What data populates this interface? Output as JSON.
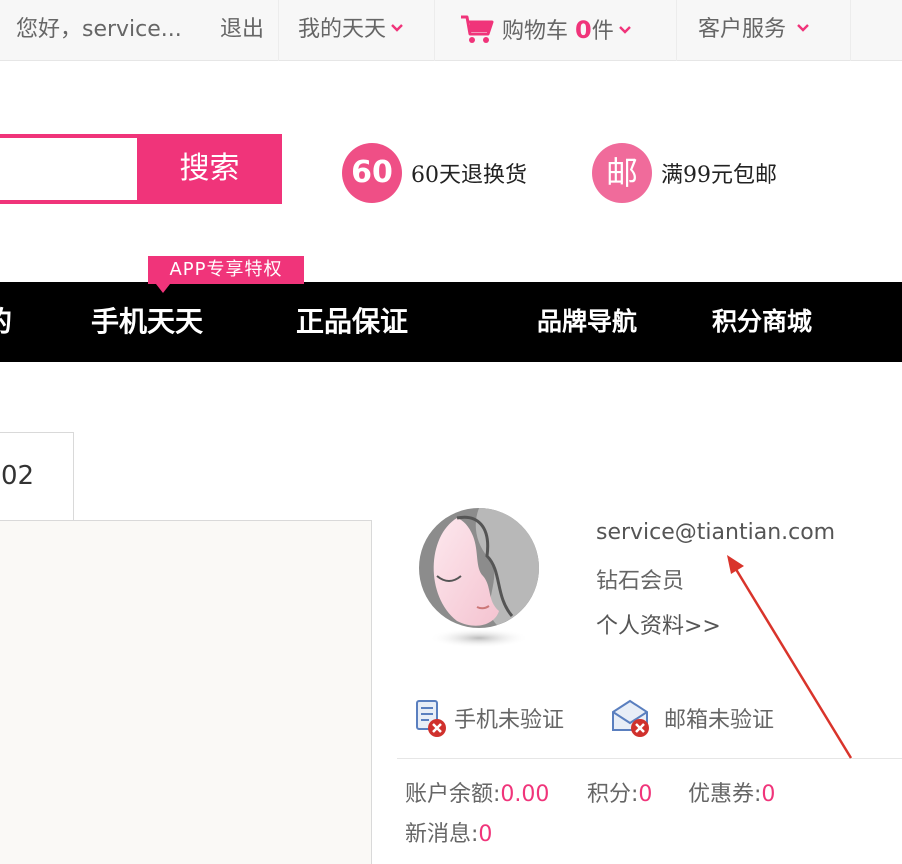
{
  "topbar": {
    "greeting": "您好，service...",
    "logout": "退出",
    "my_account": "我的天天",
    "cart_label": "购物车",
    "cart_count": "0",
    "cart_unit": "件",
    "customer_service": "客户服务"
  },
  "search": {
    "button_label": "搜索",
    "placeholder": ""
  },
  "promos": [
    {
      "badge": "60",
      "text": "60天退换货"
    },
    {
      "badge": "邮",
      "text": "满99元包邮"
    }
  ],
  "nav": {
    "partial_first": "的",
    "items": [
      "手机天天",
      "正品保证",
      "品牌导航",
      "积分商城"
    ],
    "app_tag": "APP专享特权"
  },
  "left_panel": {
    "tab_text": "02"
  },
  "user": {
    "email": "service@tiantian.com",
    "level": "钻石会员",
    "profile_link": "个人资料>>",
    "phone_status": "手机未验证",
    "email_status": "邮箱未验证"
  },
  "stats": {
    "balance_label": "账户余额:",
    "balance_value": "0.00",
    "points_label": "积分:",
    "points_value": "0",
    "coupons_label": "优惠券:",
    "coupons_value": "0",
    "messages_label": "新消息:",
    "messages_value": "0"
  },
  "colors": {
    "accent": "#f0347a",
    "nav_bg": "#000000",
    "annotation_arrow": "#d9342b"
  }
}
